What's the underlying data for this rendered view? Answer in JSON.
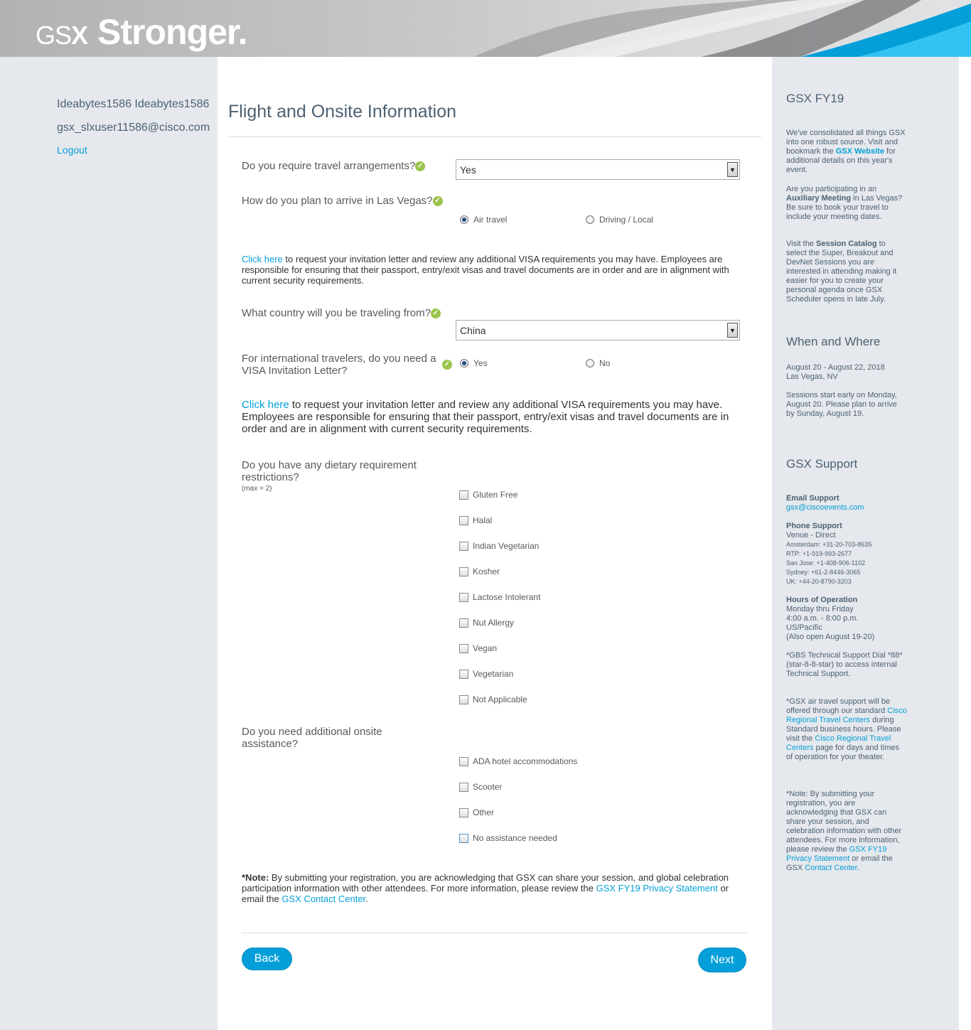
{
  "header": {
    "logo_gs": "GS",
    "logo_x": "X",
    "tagline": "Stronger."
  },
  "user": {
    "name": "Ideabytes1586 Ideabytes1586",
    "email": "gsx_slxuser11586@cisco.com",
    "logout": "Logout"
  },
  "form": {
    "title": "Flight and Onsite Information",
    "travel_question": "Do you require travel arrangements?",
    "travel_value": "Yes",
    "arrive_question": "How do you plan to arrive in Las Vegas?",
    "arrive_options": [
      "Air travel",
      "Driving / Local"
    ],
    "arrive_selected": "Air travel",
    "visa_para1_link": "Click here",
    "visa_para1_text": " to request your invitation letter and review any additional VISA requirements you may have. Employees are responsible for ensuring that their passport, entry/exit visas and travel documents are in order and are in alignment with current security requirements.",
    "country_question": "What country will you be traveling from?",
    "country_value": "China",
    "visa_question": "For international travelers, do you need a VISA Invitation Letter?",
    "visa_options": [
      "Yes",
      "No"
    ],
    "visa_selected": "Yes",
    "visa_para2_link": "Click here",
    "visa_para2_text": " to request your invitation letter and review any additional VISA requirements you may have.  Employees are responsible for ensuring that their passport, entry/exit visas and travel documents are in order and are in alignment with current security requirements.",
    "dietary_question": "Do you have any dietary requirement restrictions?",
    "dietary_max": "(max = 2)",
    "dietary_options": [
      "Gluten Free",
      "Halal",
      "Indian Vegetarian",
      "Kosher",
      "Lactose Intolerant",
      "Nut Allergy",
      "Vegan",
      "Vegetarian",
      "Not Applicable"
    ],
    "assist_question": "Do you need additional onsite assistance?",
    "assist_options": [
      "ADA hotel accommodations",
      "Scooter",
      "Other",
      "No assistance needed"
    ],
    "note_label": "*Note:",
    "note_text": "  By submitting your registration, you are acknowledging that GSX can share your session, and global celebration participation information with other attendees.  For more information, please review the ",
    "note_link1": "GSX FY19 Privacy Statement",
    "note_mid": " or email the ",
    "note_link2": "GSX Contact Center",
    "note_end": ".",
    "back_label": "Back",
    "next_label": "Next"
  },
  "sidebar": {
    "h1": "GSX FY19",
    "p1_a": "We've consolidated all things GSX into one robust source. Visit and bookmark the ",
    "p1_link": "GSX Website",
    "p1_b": " for additional details on this year's event.",
    "p2_a": "Are you participating in an ",
    "p2_bold": "Auxiliary Meeting",
    "p2_b": " in Las Vegas?  Be sure to book your travel to include your meeting dates.",
    "p3_a": "Visit the ",
    "p3_bold": "Session Catalog",
    "p3_b": " to select the Super, Breakout and DevNet Sessions you are interested in attending making it easier for you to create your personal agenda once GSX Scheduler opens in late July.",
    "h2": "When and Where",
    "dates": "August 20 - August 22, 2018",
    "location": "Las Vegas, NV",
    "sessions_note": "Sessions start early on Monday, August 20.  Please plan to arrive by Sunday, August 19.",
    "h3": "GSX Support",
    "email_label": "Email Support",
    "email": "gsx@ciscoevents.com",
    "phone_label": "Phone Support",
    "venue": "Venue - Direct",
    "phones": [
      "Amsterdam: +31-20-703-8635",
      "RTP: +1-919-993-2677",
      "San Jose: +1-408-906-1102",
      "Sydney: +61-2-8446-3065",
      "UK: +44-20-8790-3203"
    ],
    "hours_label": "Hours of Operation",
    "hours": [
      "Monday thru Friday",
      "4:00 a.m. - 8:00 p.m.",
      "US/Pacific",
      "(Also open August 19-20)"
    ],
    "gbs_note": "*GBS Technical Support Dial *88* (star-8-8-star) to access internal Technical Support.",
    "air_a": "*GSX air travel support will be offered through our standard ",
    "air_link1": "Cisco Regional Travel Centers",
    "air_b": " during Standard business hours. Please visit the ",
    "air_link2": "Cisco Regional Travel Centers",
    "air_c": " page for days and times of operation for your theater.",
    "note_a": "*Note: By submitting your registration, you are acknowledging that GSX can share your session, and celebration information with other attendees. For more information, please review the ",
    "note_link1": "GSX FY19 Privacy Statement",
    "note_b": " or email the GSX ",
    "note_link2": "Contact Center",
    "note_c": "."
  }
}
